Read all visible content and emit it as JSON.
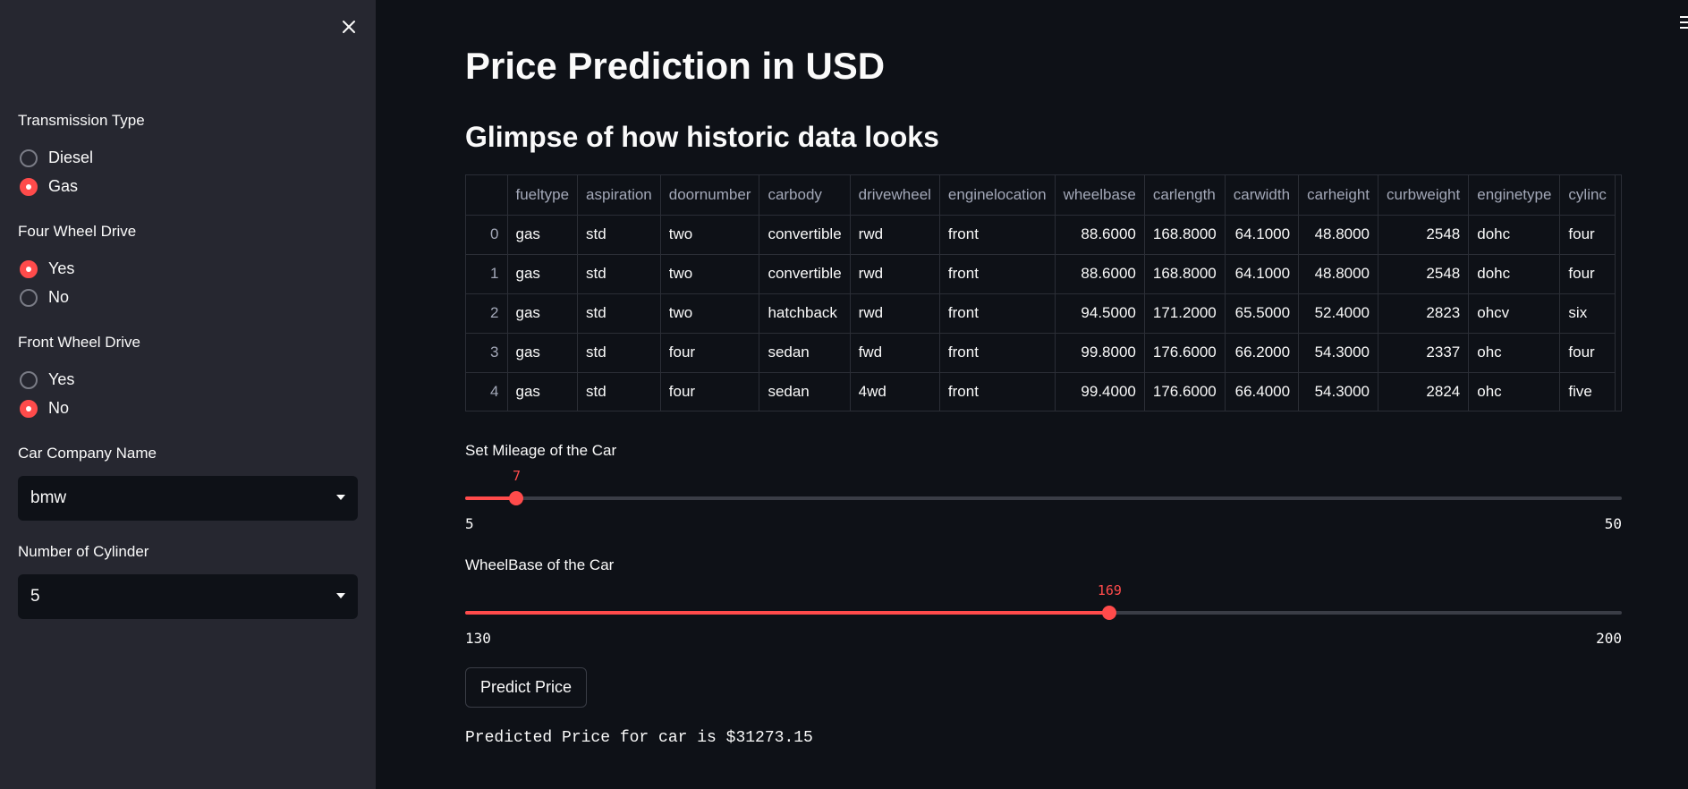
{
  "sidebar": {
    "transmission": {
      "label": "Transmission Type",
      "options": [
        "Diesel",
        "Gas"
      ],
      "selected": "Gas"
    },
    "four_wheel": {
      "label": "Four Wheel Drive",
      "options": [
        "Yes",
        "No"
      ],
      "selected": "Yes"
    },
    "front_wheel": {
      "label": "Front Wheel Drive",
      "options": [
        "Yes",
        "No"
      ],
      "selected": "No"
    },
    "company": {
      "label": "Car Company Name",
      "value": "bmw"
    },
    "cylinder": {
      "label": "Number of Cylinder",
      "value": "5"
    }
  },
  "main": {
    "title": "Price Prediction in USD",
    "subtitle": "Glimpse of how historic data looks",
    "table": {
      "columns": [
        "",
        "fueltype",
        "aspiration",
        "doornumber",
        "carbody",
        "drivewheel",
        "enginelocation",
        "wheelbase",
        "carlength",
        "carwidth",
        "carheight",
        "curbweight",
        "enginetype",
        "cylinc"
      ],
      "rows": [
        [
          "0",
          "gas",
          "std",
          "two",
          "convertible",
          "rwd",
          "front",
          "88.6000",
          "168.8000",
          "64.1000",
          "48.8000",
          "2548",
          "dohc",
          "four"
        ],
        [
          "1",
          "gas",
          "std",
          "two",
          "convertible",
          "rwd",
          "front",
          "88.6000",
          "168.8000",
          "64.1000",
          "48.8000",
          "2548",
          "dohc",
          "four"
        ],
        [
          "2",
          "gas",
          "std",
          "two",
          "hatchback",
          "rwd",
          "front",
          "94.5000",
          "171.2000",
          "65.5000",
          "52.4000",
          "2823",
          "ohcv",
          "six"
        ],
        [
          "3",
          "gas",
          "std",
          "four",
          "sedan",
          "fwd",
          "front",
          "99.8000",
          "176.6000",
          "66.2000",
          "54.3000",
          "2337",
          "ohc",
          "four"
        ],
        [
          "4",
          "gas",
          "std",
          "four",
          "sedan",
          "4wd",
          "front",
          "99.4000",
          "176.6000",
          "66.4000",
          "54.3000",
          "2824",
          "ohc",
          "five"
        ]
      ]
    },
    "mileage_slider": {
      "label": "Set Mileage of the Car",
      "value": 7,
      "min": 5,
      "max": 50
    },
    "wheelbase_slider": {
      "label": "WheelBase of the Car",
      "value": 169,
      "min": 130,
      "max": 200
    },
    "predict_button": "Predict Price",
    "result": "Predicted Price for car is $31273.15"
  },
  "colors": {
    "accent": "#ff4b4b",
    "sidebar_bg": "#262730",
    "main_bg": "#0e1117"
  },
  "icons": {
    "close": "close-icon",
    "menu": "hamburger-menu-icon",
    "caret": "chevron-down-icon"
  }
}
